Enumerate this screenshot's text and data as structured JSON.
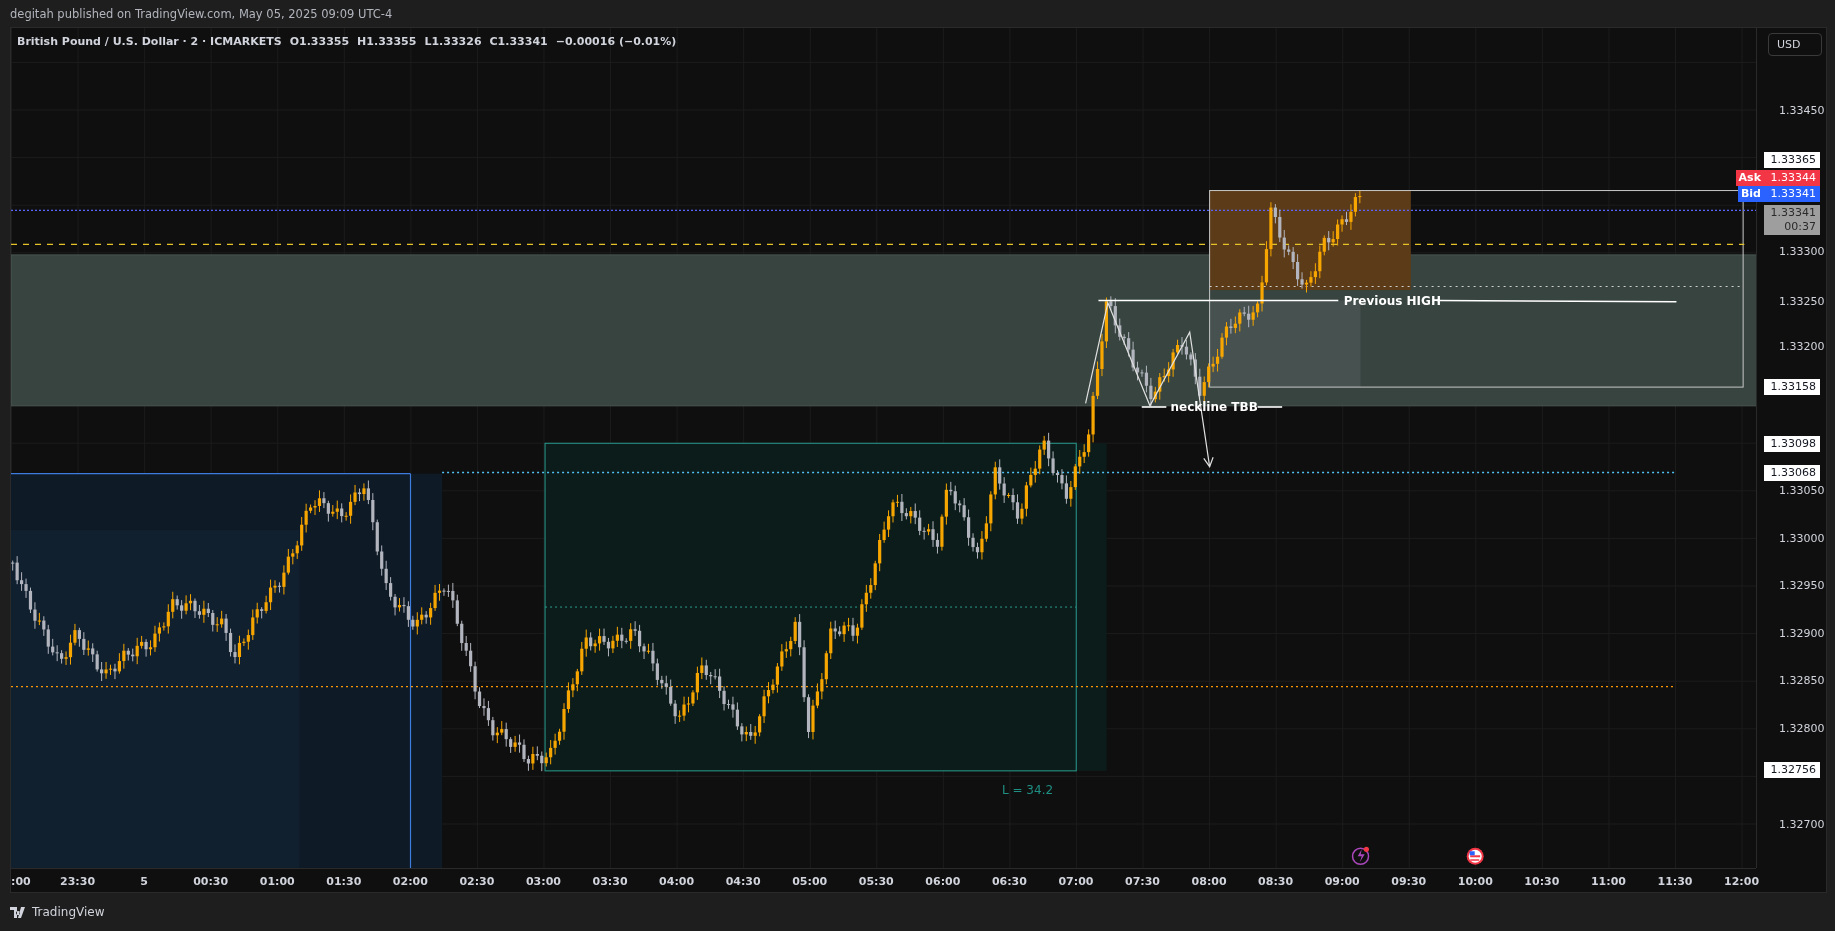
{
  "header": {
    "text": "degitah published on TradingView.com, May 05, 2025 09:09 UTC-4"
  },
  "legend": {
    "symbol": "British Pound / U.S. Dollar · 2 · ICMARKETS",
    "ohlc": [
      "O1.33355",
      "H1.33355",
      "L1.33326",
      "C1.33341"
    ],
    "change": "−0.00016 (−0.01%)"
  },
  "drawings": {
    "previous_high": "Previous HIGH",
    "neckline": "neckline TBB",
    "range_length": "L = 34.2"
  },
  "price_axis": {
    "currency": "USD",
    "ticks": [
      "1.33450",
      "1.33300",
      "1.33250",
      "1.33200",
      "1.33050",
      "1.33000",
      "1.32950",
      "1.32900",
      "1.32850",
      "1.32800",
      "1.32700"
    ],
    "markers": [
      {
        "kind": "label",
        "value": "1.33365"
      },
      {
        "kind": "ask",
        "tag": "Ask",
        "value": "1.33344"
      },
      {
        "kind": "bid",
        "tag": "Bid",
        "value": "1.33341"
      },
      {
        "kind": "countdown",
        "value": "1.33341",
        "timer": "00:37"
      },
      {
        "kind": "label",
        "value": "1.33158"
      },
      {
        "kind": "label",
        "value": "1.33098"
      },
      {
        "kind": "label",
        "value": "1.33068"
      },
      {
        "kind": "label",
        "value": "1.32756"
      }
    ]
  },
  "time_axis": [
    ":00",
    "23:30",
    "5",
    "00:30",
    "01:00",
    "01:30",
    "02:00",
    "02:30",
    "03:00",
    "03:30",
    "04:00",
    "04:30",
    "05:00",
    "05:30",
    "06:00",
    "06:30",
    "07:00",
    "07:30",
    "08:00",
    "08:30",
    "09:00",
    "09:30",
    "10:00",
    "10:30",
    "11:00",
    "11:30",
    "12:00"
  ],
  "footer": {
    "brand": "TradingView"
  }
}
